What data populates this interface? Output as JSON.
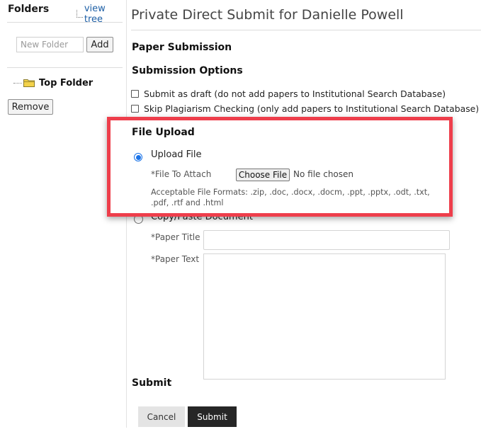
{
  "sidebar": {
    "title": "Folders",
    "view_tree": "view tree",
    "new_folder_placeholder": "New Folder",
    "add_label": "Add",
    "folders": [
      {
        "name": "Top Folder"
      }
    ],
    "remove_label": "Remove"
  },
  "main": {
    "page_title": "Private Direct Submit for Danielle Powell",
    "paper_submission_heading": "Paper Submission",
    "submission_options_heading": "Submission Options",
    "options": [
      {
        "label": "Submit as draft (do not add papers to Institutional Search Database)",
        "checked": false
      },
      {
        "label": "Skip Plagiarism Checking (only add papers to Institutional Search Database)",
        "checked": false
      }
    ],
    "file_upload": {
      "heading": "File Upload",
      "upload_option_label": "Upload File",
      "upload_selected": true,
      "file_label": "*File To Attach",
      "choose_button": "Choose File",
      "no_file_text": "No file chosen",
      "formats_text": "Acceptable File Formats: .zip, .doc, .docx, .docm, .ppt, .pptx, .odt, .txt, .pdf, .rtf and .html"
    },
    "copy_paste": {
      "option_label": "Copy/Paste Document",
      "selected": false,
      "paper_title_label": "*Paper Title",
      "paper_title_value": "",
      "paper_text_label": "*Paper Text",
      "paper_text_value": ""
    },
    "submit_heading": "Submit",
    "cancel_label": "Cancel",
    "submit_label": "Submit"
  },
  "colors": {
    "highlight": "#ee3e4b",
    "link": "#1d5fa6",
    "radio_accent": "#1a73e8",
    "submit_bg": "#262626",
    "folder_icon": "#f3d24a"
  },
  "icons": [
    "folder-icon",
    "tree-icon"
  ]
}
